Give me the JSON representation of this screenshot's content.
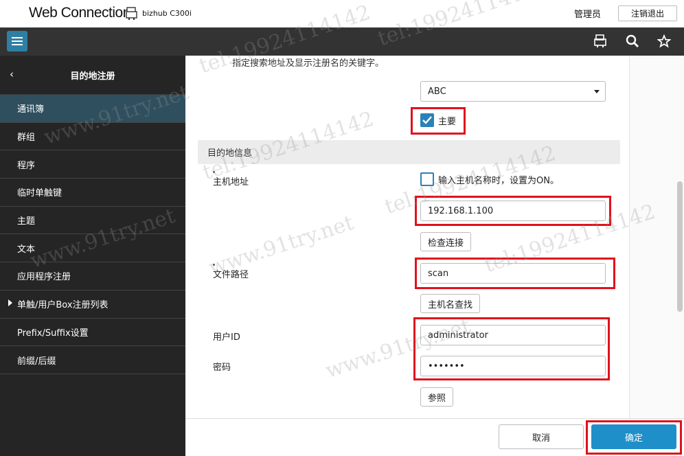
{
  "header": {
    "brand": "Web Connection",
    "model": "bizhub C300i",
    "admin_label": "管理员",
    "logout_label": "注销退出"
  },
  "navbar": {
    "icons": [
      "menu-icon",
      "printer-icon",
      "search-icon",
      "star-icon"
    ]
  },
  "sidebar": {
    "back_icon": "‹",
    "title": "目的地注册",
    "items": [
      {
        "label": "通讯簿",
        "active": true
      },
      {
        "label": "群组"
      },
      {
        "label": "程序"
      },
      {
        "label": "临时单触键"
      },
      {
        "label": "主题"
      },
      {
        "label": "文本"
      },
      {
        "label": "应用程序注册"
      },
      {
        "label": "单触/用户Box注册列表",
        "expandable": true
      },
      {
        "label": "Prefix/Suffix设置"
      },
      {
        "label": "前缀/后缀"
      }
    ]
  },
  "form": {
    "hint": "指定搜索地址及显示注册名的关键字。",
    "index_select": "ABC",
    "main_checkbox_label": "主要",
    "main_checked": true,
    "section_title": "目的地信息",
    "host_label": "主机地址",
    "host_checkbox_label": "输入主机名称时，设置为ON。",
    "host_value": "192.168.1.100",
    "check_connection_label": "检查连接",
    "path_label": "文件路径",
    "path_value": "scan",
    "host_search_label": "主机名查找",
    "user_label": "用户ID",
    "user_value": "administrator",
    "password_label": "密码",
    "password_value": "•••••••",
    "browse_label": "参照"
  },
  "footer": {
    "cancel_label": "取消",
    "ok_label": "确定"
  },
  "watermarks": [
    "tel:19924114142",
    "www.91try.net"
  ],
  "colors": {
    "accent": "#1f8fc9",
    "highlight": "#e0101c",
    "sidebar_bg": "#252525",
    "navbar_bg": "#333333"
  }
}
